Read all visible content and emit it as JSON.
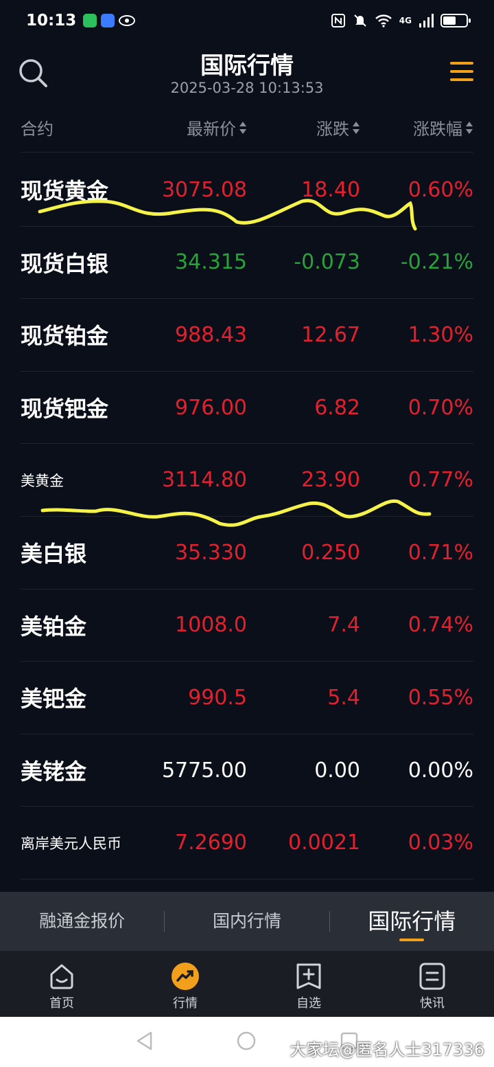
{
  "status_bar": {
    "time": "10:13",
    "network": "4G"
  },
  "header": {
    "title": "国际行情",
    "datetime": "2025-03-28 10:13:53"
  },
  "columns": {
    "name": "合约",
    "price": "最新价",
    "change": "涨跌",
    "pct": "涨跌幅"
  },
  "rows": [
    {
      "name": "现货黄金",
      "price": "3075.08",
      "change": "18.40",
      "pct": "0.60%",
      "trend": "up"
    },
    {
      "name": "现货白银",
      "price": "34.315",
      "change": "-0.073",
      "pct": "-0.21%",
      "trend": "down"
    },
    {
      "name": "现货铂金",
      "price": "988.43",
      "change": "12.67",
      "pct": "1.30%",
      "trend": "up"
    },
    {
      "name": "现货钯金",
      "price": "976.00",
      "change": "6.82",
      "pct": "0.70%",
      "trend": "up"
    },
    {
      "name": "美黄金",
      "price": "3114.80",
      "change": "23.90",
      "pct": "0.77%",
      "trend": "up"
    },
    {
      "name": "美白银",
      "price": "35.330",
      "change": "0.250",
      "pct": "0.71%",
      "trend": "up"
    },
    {
      "name": "美铂金",
      "price": "1008.0",
      "change": "7.4",
      "pct": "0.74%",
      "trend": "up"
    },
    {
      "name": "美钯金",
      "price": "990.5",
      "change": "5.4",
      "pct": "0.55%",
      "trend": "up"
    },
    {
      "name": "美铑金",
      "price": "5775.00",
      "change": "0.00",
      "pct": "0.00%",
      "trend": "flat"
    },
    {
      "name": "离岸美元人民币",
      "price": "7.2690",
      "change": "0.0021",
      "pct": "0.03%",
      "trend": "up"
    }
  ],
  "tabs": [
    {
      "label": "融通金报价"
    },
    {
      "label": "国内行情"
    },
    {
      "label": "国际行情"
    }
  ],
  "active_tab": 2,
  "bottom_nav": [
    {
      "label": "首页",
      "icon": "home-icon"
    },
    {
      "label": "行情",
      "icon": "market-icon"
    },
    {
      "label": "自选",
      "icon": "watchlist-icon"
    },
    {
      "label": "快讯",
      "icon": "news-icon"
    }
  ],
  "watermark": "大家坛@匿名人士317336",
  "colors": {
    "up": "#e5202e",
    "down": "#27a33a",
    "accent": "#f2a01c",
    "background": "#0b0f1a",
    "highlighter": "#f5f34a"
  }
}
